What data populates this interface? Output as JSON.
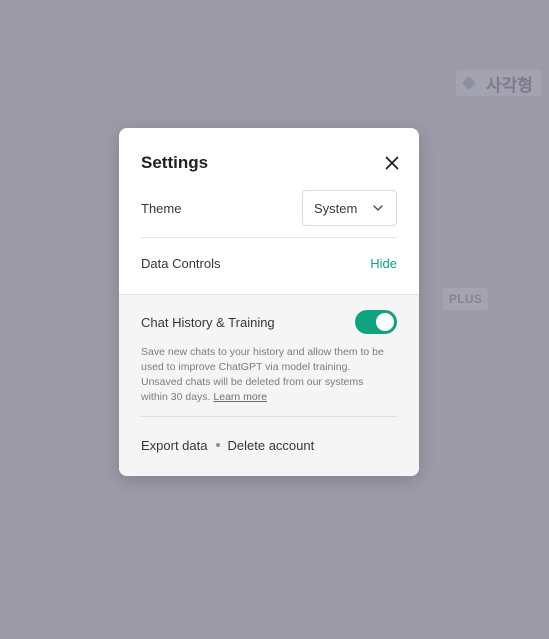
{
  "background": {
    "shape_label": "사각형",
    "shape_icon": "diamond-icon",
    "plus_badge": "PLUS"
  },
  "settings": {
    "title": "Settings",
    "close_icon": "close-icon",
    "theme": {
      "label": "Theme",
      "selected": "System",
      "dropdown_icon": "chevron-down-icon"
    },
    "data_controls": {
      "label": "Data Controls",
      "toggle_link": "Hide"
    },
    "chat_history": {
      "label": "Chat History & Training",
      "enabled": true,
      "description": "Save new chats to your history and allow them to be used to improve ChatGPT via model training. Unsaved chats will be deleted from our systems within 30 days.",
      "learn_more": "Learn more"
    },
    "actions": {
      "export": "Export data",
      "delete": "Delete account"
    }
  },
  "colors": {
    "accent": "#10a37f",
    "overlay": "#9d9ba8"
  }
}
